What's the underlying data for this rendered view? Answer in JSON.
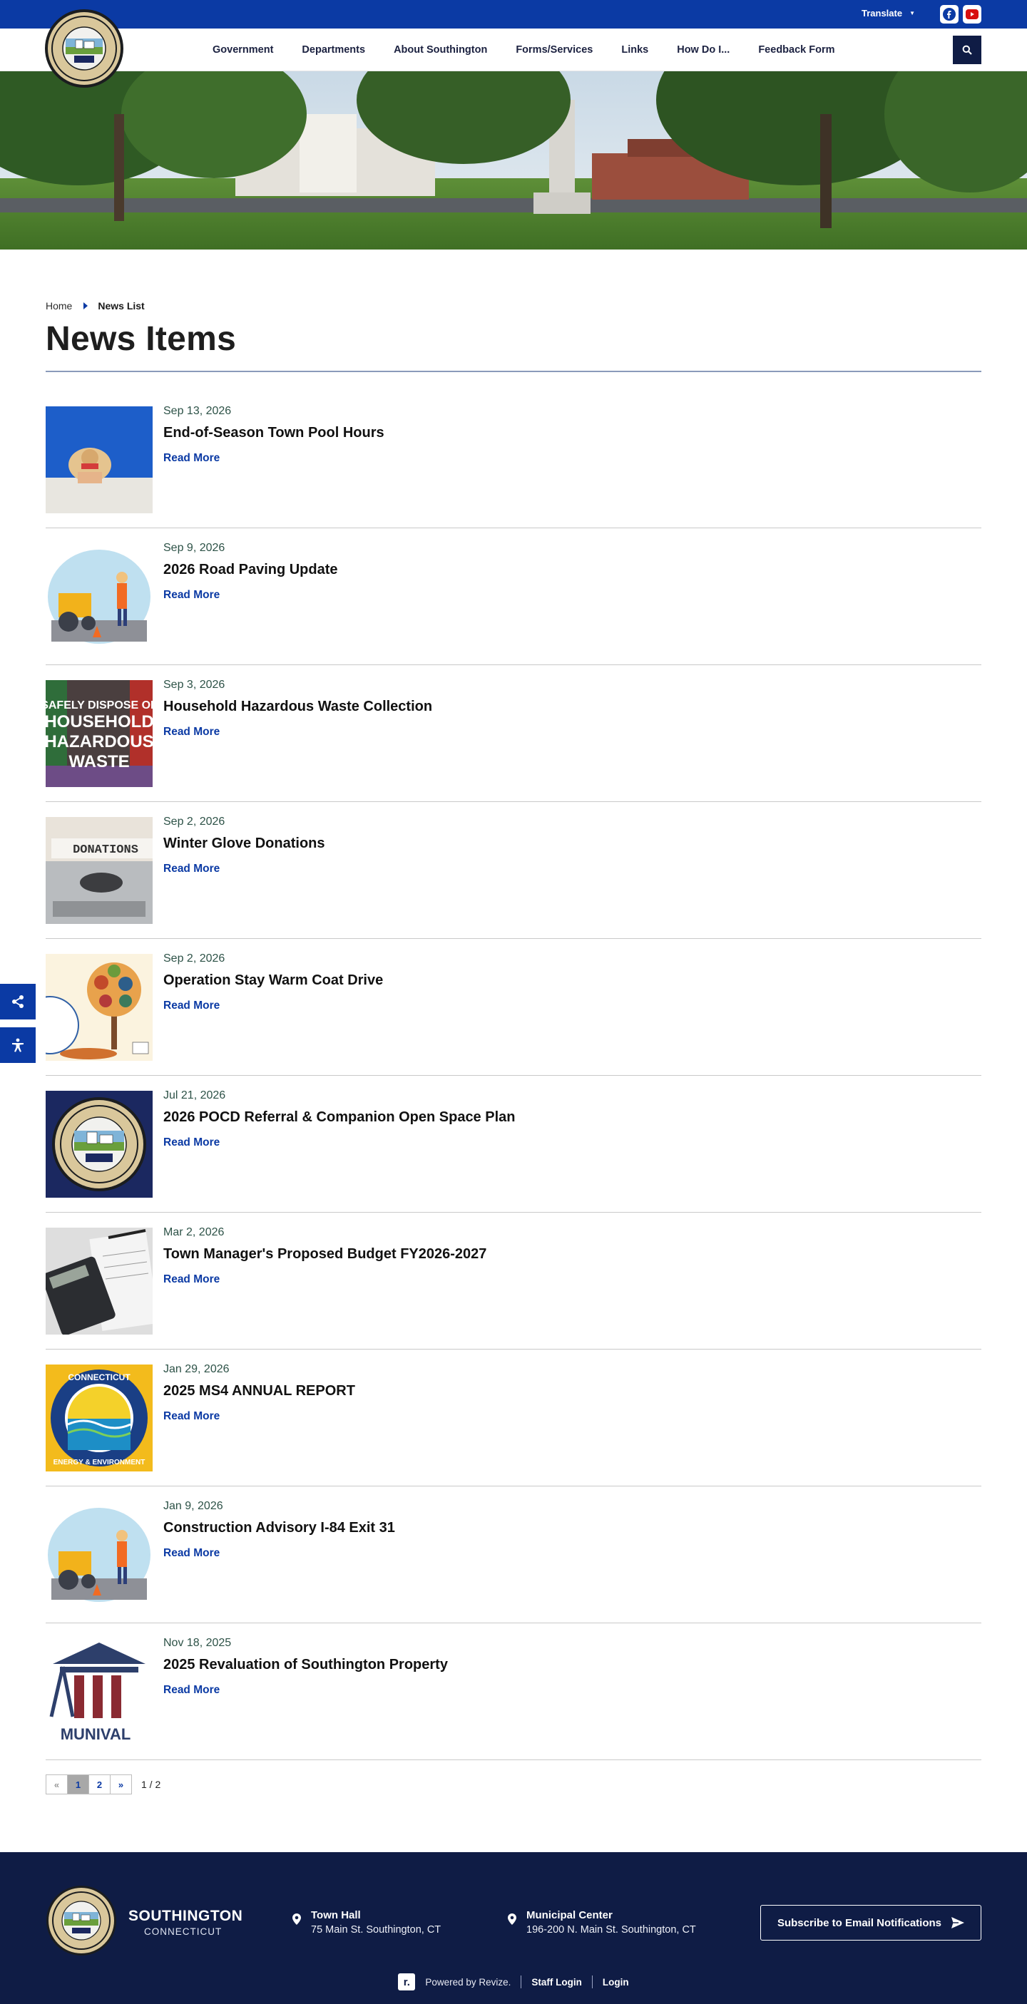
{
  "top_bar": {
    "translate_label": "Translate",
    "social": [
      "facebook-icon",
      "youtube-icon"
    ],
    "color": "#0b3aa4"
  },
  "nav": {
    "items": [
      "Government",
      "Departments",
      "About Southington",
      "Forms/Services",
      "Links",
      "How Do I...",
      "Feedback Form"
    ]
  },
  "breadcrumb": {
    "home": "Home",
    "current": "News List"
  },
  "page_title": "News Items",
  "news": [
    {
      "date": "Sep 13, 2026",
      "title": "End-of-Season Town Pool Hours",
      "link": "Read More",
      "thumb": "pool-hat-image"
    },
    {
      "date": "Sep 9, 2026",
      "title": "2026 Road Paving Update",
      "link": "Read More",
      "thumb": "road-roller-image"
    },
    {
      "date": "Sep 3, 2026",
      "title": "Household Hazardous Waste Collection",
      "link": "Read More",
      "thumb": "hazardous-waste-image",
      "thumb_text": [
        "SAFELY DISPOSE OF",
        "HOUSEHOLD",
        "HAZARDOUS",
        "WASTE"
      ]
    },
    {
      "date": "Sep 2, 2026",
      "title": "Winter Glove Donations",
      "link": "Read More",
      "thumb": "typewriter-donations-image",
      "thumb_text": [
        "DONATIONS"
      ]
    },
    {
      "date": "Sep 2, 2026",
      "title": "Operation Stay Warm Coat Drive",
      "link": "Read More",
      "thumb": "coat-tree-image"
    },
    {
      "date": "Jul 21, 2026",
      "title": "2026 POCD Referral & Companion Open Space Plan",
      "link": "Read More",
      "thumb": "town-seal-image"
    },
    {
      "date": "Mar 2, 2026",
      "title": "Town Manager's Proposed Budget FY2026-2027",
      "link": "Read More",
      "thumb": "calculator-image"
    },
    {
      "date": "Jan 29, 2026",
      "title": "2025 MS4 ANNUAL REPORT",
      "link": "Read More",
      "thumb": "ct-energy-environment-image",
      "thumb_text": [
        "CONNECTICUT",
        "ENERGY & ENVIRONMENT"
      ]
    },
    {
      "date": "Jan 9, 2026",
      "title": "Construction Advisory I-84 Exit 31",
      "link": "Read More",
      "thumb": "road-roller-image"
    },
    {
      "date": "Nov 18, 2025",
      "title": "2025 Revaluation of Southington Property",
      "link": "Read More",
      "thumb": "munival-image",
      "thumb_text": [
        "MUNIVAL"
      ]
    }
  ],
  "pagination": {
    "prev": "«",
    "pages": [
      "1",
      "2"
    ],
    "next": "»",
    "count": "1 / 2",
    "current": 1
  },
  "footer": {
    "name": "SOUTHINGTON",
    "sub": "CONNECTICUT",
    "locations": [
      {
        "title": "Town Hall",
        "address": "75 Main St. Southington, CT"
      },
      {
        "title": "Municipal Center",
        "address": "196-200 N. Main St. Southington, CT"
      }
    ],
    "subscribe": "Subscribe to Email Notifications",
    "powered": "Powered by Revize.",
    "staff_login": "Staff Login",
    "login": "Login",
    "revize_mark": "r."
  },
  "colors": {
    "brand_blue": "#0b3aa4",
    "navy": "#0f1c45",
    "date_green": "#2d5247"
  }
}
